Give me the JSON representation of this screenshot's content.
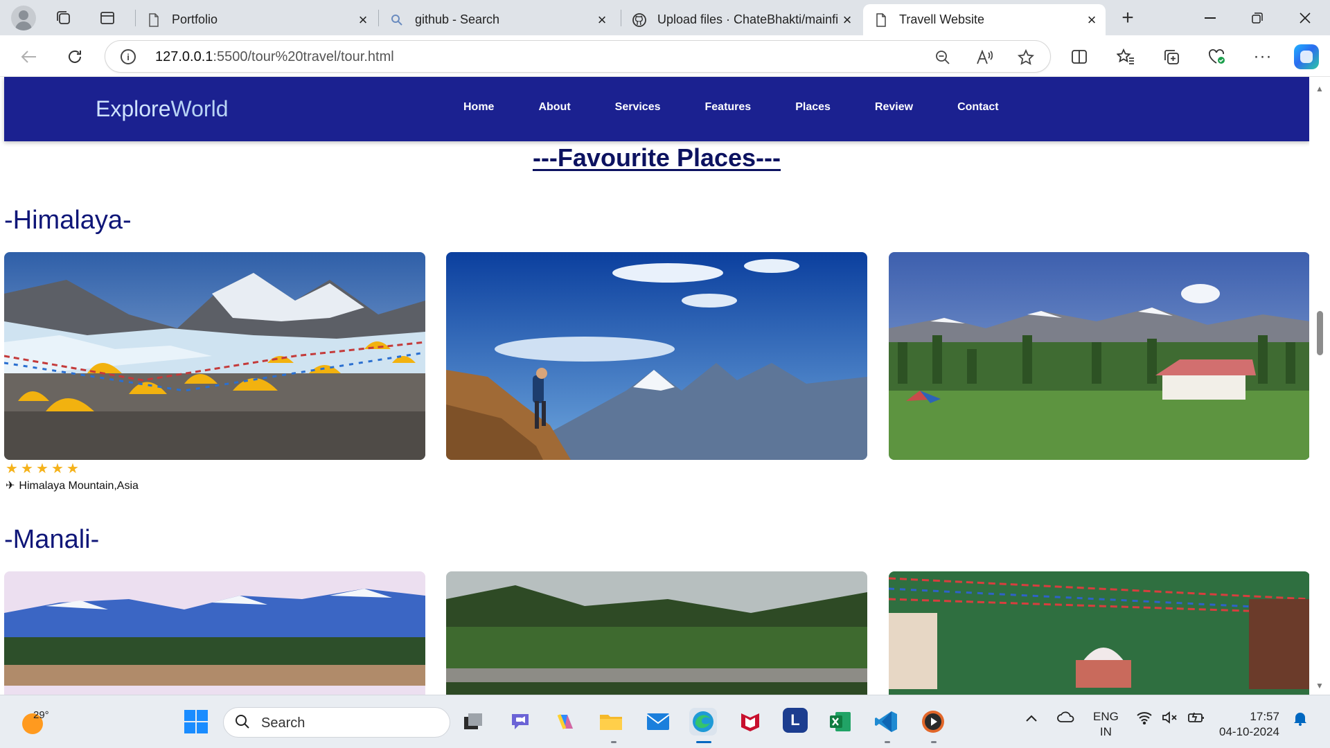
{
  "browser": {
    "tabs": [
      {
        "title": "Portfolio",
        "favicon": "page-icon"
      },
      {
        "title": "github - Search",
        "favicon": "search-icon"
      },
      {
        "title": "Upload files · ChateBhakti/mainfi",
        "favicon": "github-icon"
      },
      {
        "title": "Travell Website",
        "favicon": "page-icon",
        "active": true
      }
    ],
    "url_host": "127.0.0.1",
    "url_path": ":5500/tour%20travel/tour.html"
  },
  "site": {
    "logo_part1": "Explore",
    "logo_part2": "World",
    "nav": [
      "Home",
      "About",
      "Services",
      "Features",
      "Places",
      "Review",
      "Contact"
    ],
    "section_title": "---Favourite Places---",
    "places": [
      {
        "heading": "-Himalaya-",
        "rating": 5,
        "caption": "Himalaya Mountain,Asia"
      },
      {
        "heading": "-Manali-"
      }
    ]
  },
  "taskbar": {
    "temperature": "29°",
    "search_placeholder": "Search",
    "language_line1": "ENG",
    "language_line2": "IN",
    "time": "17:57",
    "date": "04-10-2024"
  },
  "colors": {
    "site_nav_bg": "#1b2190",
    "heading_color": "#0f1678",
    "star_color": "#f5b21a"
  }
}
